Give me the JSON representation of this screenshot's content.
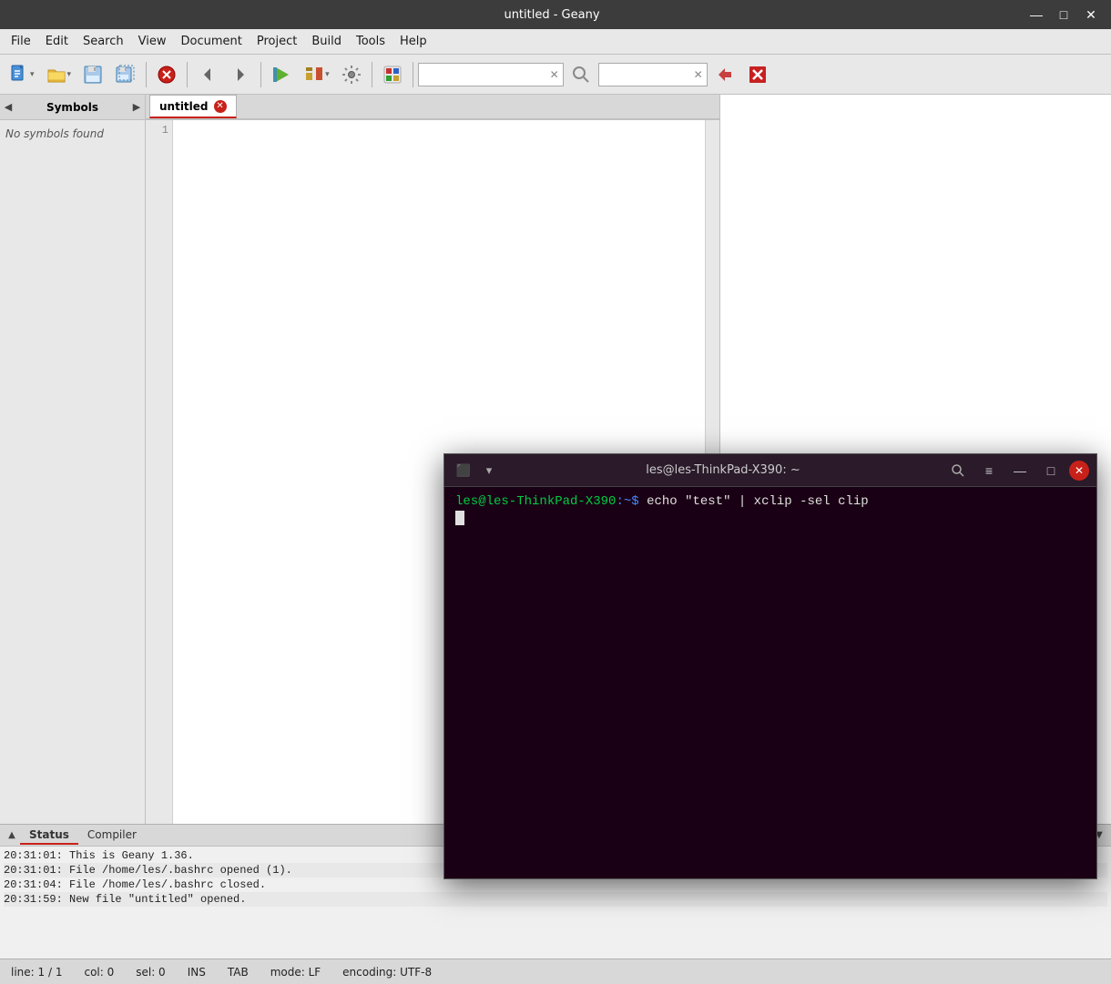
{
  "window": {
    "title": "untitled - Geany",
    "minimize_btn": "—",
    "maximize_btn": "□",
    "close_btn": "✕"
  },
  "menubar": {
    "items": [
      "File",
      "Edit",
      "Search",
      "View",
      "Document",
      "Project",
      "Build",
      "Tools",
      "Help"
    ]
  },
  "toolbar": {
    "search_placeholder": "",
    "search_clear": "✕"
  },
  "sidebar": {
    "tab_label": "Symbols",
    "no_symbols": "No symbols found"
  },
  "doc_tabs": [
    {
      "label": "untitled",
      "active": true
    }
  ],
  "editor": {
    "line_numbers": [
      "1"
    ]
  },
  "status_panel": {
    "tabs": [
      "Status",
      "Compiler"
    ],
    "active_tab": "Status",
    "log_lines": [
      "20:31:01: This is Geany 1.36.",
      "20:31:01: File /home/les/.bashrc opened (1).",
      "20:31:04: File /home/les/.bashrc closed.",
      "20:31:59: New file \"untitled\" opened."
    ]
  },
  "statusbar": {
    "line": "line: 1 / 1",
    "col": "col: 0",
    "sel": "sel: 0",
    "ins": "INS",
    "tab": "TAB",
    "mode": "mode: LF",
    "encoding": "encoding: UTF-8"
  },
  "terminal": {
    "title": "les@les-ThinkPad-X390: ~",
    "prompt_user": "les@les-ThinkPad-X390",
    "prompt_symbol": ":~$",
    "command": "echo \"test\" | xclip -sel clip",
    "close_btn": "✕",
    "minimize_btn": "—",
    "maximize_btn": "□"
  }
}
